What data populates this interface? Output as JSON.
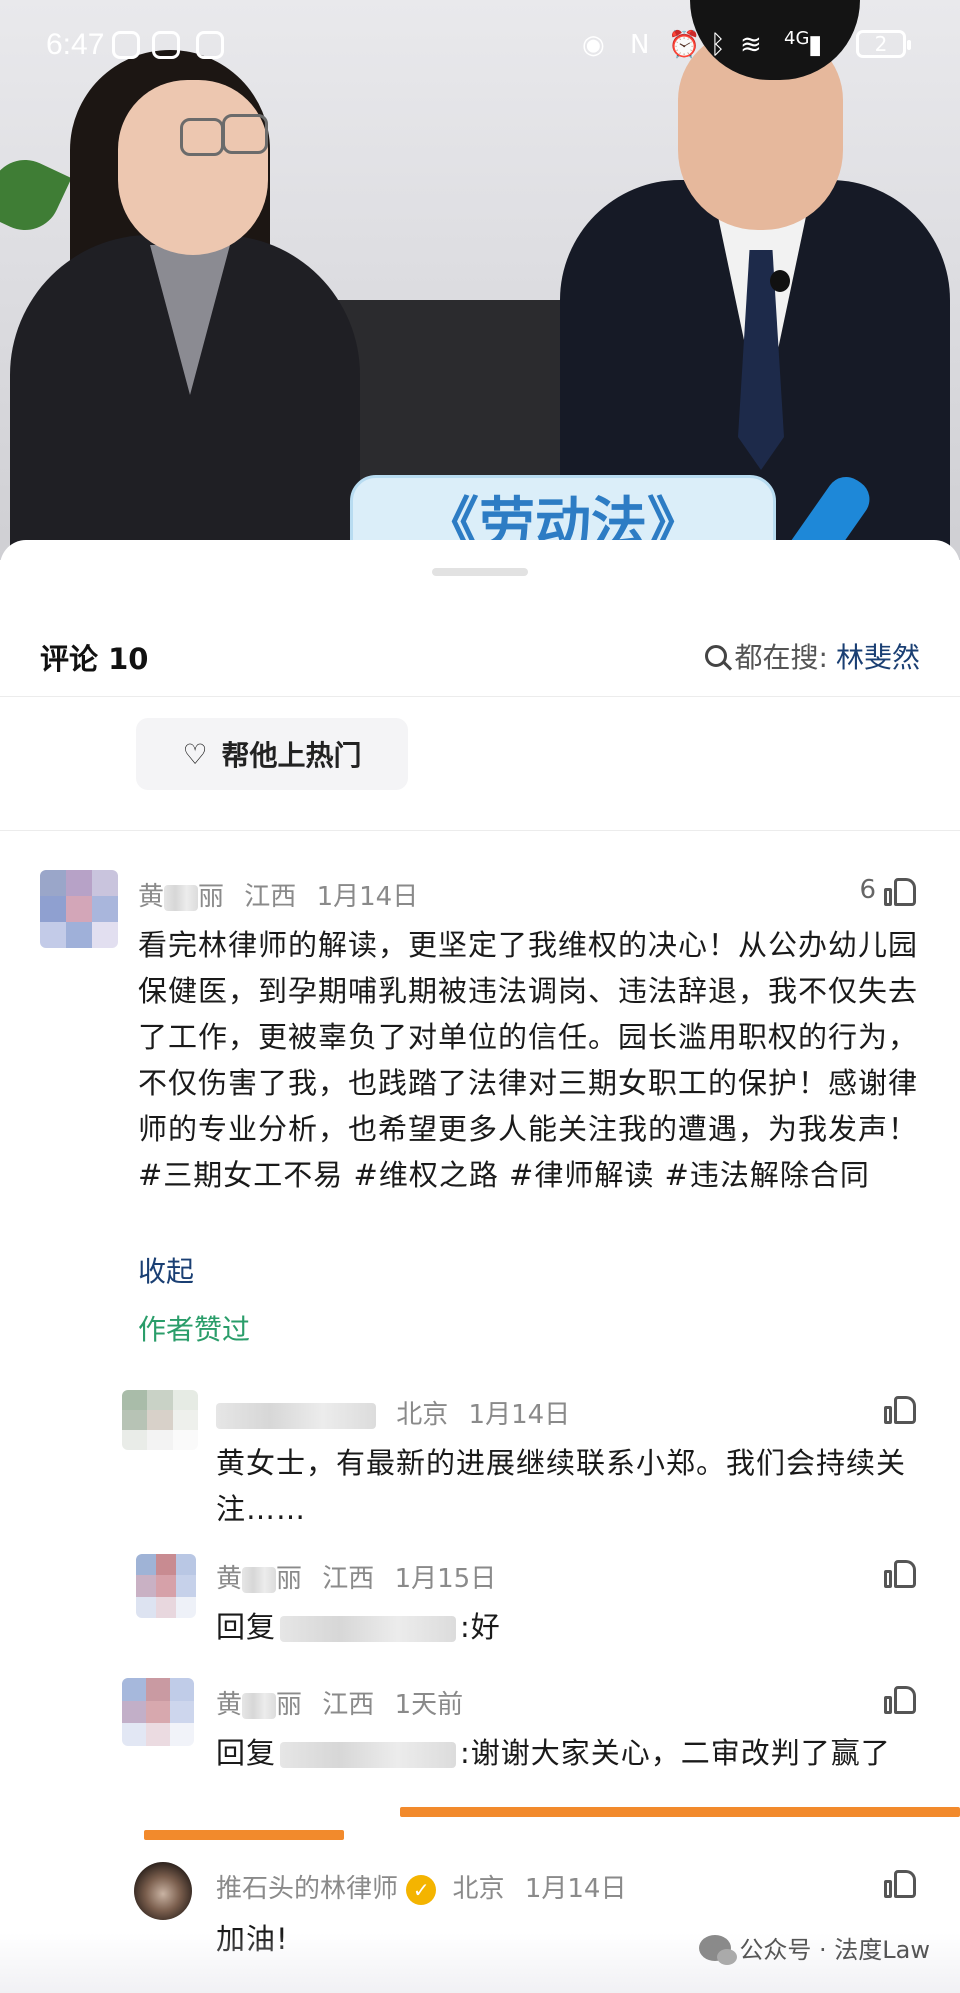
{
  "status_bar": {
    "time": "6:47",
    "network": "4G",
    "battery": "2",
    "icons": [
      "eye-icon",
      "nfc-icon",
      "alarm-icon",
      "bluetooth-icon",
      "wifi-icon",
      "signal-icon"
    ]
  },
  "video": {
    "banner_text": "《劳动法》"
  },
  "comments_panel": {
    "title": "评论 10",
    "search_hint_prefix": "都在搜:",
    "search_hint_keyword": "林斐然",
    "hot_button_label": "帮他上热门"
  },
  "main_comment": {
    "user_first": "黄",
    "user_last": "丽",
    "location": "江西",
    "date": "1月14日",
    "likes": "6",
    "text": "看完林律师的解读，更坚定了我维权的决心！从公办幼儿园保健医，到孕期哺乳期被违法调岗、违法辞退，我不仅失去了工作，更被辜负了对单位的信任。园长滥用职权的行为，不仅伤害了我，也践踏了法律对三期女职工的保护！感谢律师的专业分析，也希望更多人能关注我的遭遇，为我发声！#三期女工不易 #维权之路 #律师解读 #违法解除合同",
    "collapse_label": "收起",
    "author_liked_label": "作者赞过"
  },
  "replies": [
    {
      "location": "北京",
      "date": "1月14日",
      "text": "黄女士，有最新的进展继续联系小郑。我们会持续关注……"
    },
    {
      "user_first": "黄",
      "user_last": "丽",
      "location": "江西",
      "date": "1月15日",
      "reply_prefix": "回复",
      "reply_suffix": ":好"
    },
    {
      "user_first": "黄",
      "user_last": "丽",
      "location": "江西",
      "date": "1天前",
      "reply_prefix": "回复",
      "reply_suffix": ":谢谢大家关心，二审改判了赢了"
    },
    {
      "user": "推石头的林律师",
      "location": "北京",
      "date": "1月14日",
      "text": "加油!"
    }
  ],
  "watermark": "公众号 · 法度Law",
  "colors": {
    "link": "#1a3f73",
    "author_liked": "#2a9d6a",
    "highlight_underline": "#f28a2c",
    "verified_badge": "#f4b400"
  }
}
